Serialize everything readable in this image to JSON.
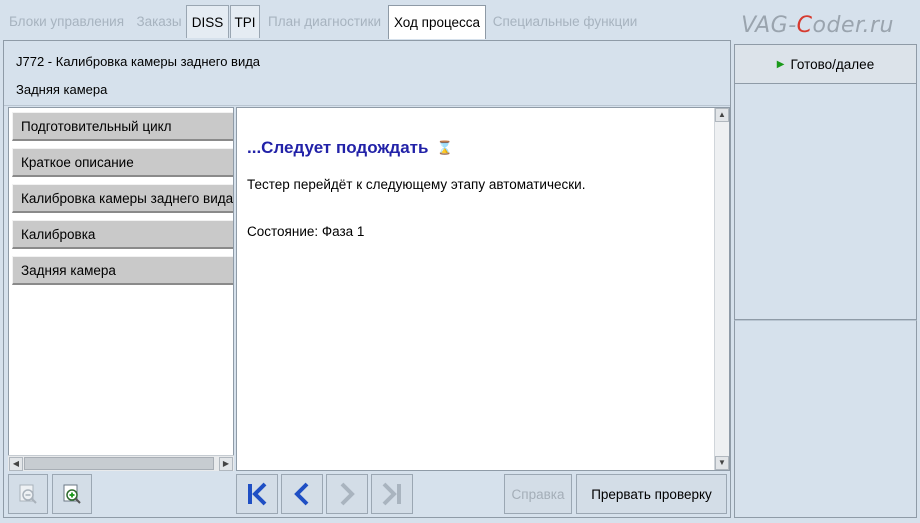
{
  "tabs": [
    {
      "label": "Блоки управления",
      "state": "disabled"
    },
    {
      "label": "Заказы",
      "state": "disabled"
    },
    {
      "label": "DISS",
      "state": "enabled"
    },
    {
      "label": "TPI",
      "state": "enabled"
    },
    {
      "label": "План диагностики",
      "state": "disabled"
    },
    {
      "label": "Ход процесса",
      "state": "active"
    },
    {
      "label": "Специальные функции",
      "state": "disabled"
    }
  ],
  "watermark": {
    "part1": "VAG-",
    "part2": "C",
    "part3": "oder.ru"
  },
  "header": {
    "title": "J772 - Калибровка камеры заднего вида",
    "subtitle": "Задняя камера"
  },
  "steps": [
    "Подготовительный цикл",
    "Краткое описание",
    "Калибровка камеры заднего вида",
    "Калибровка",
    "Задняя камера"
  ],
  "content": {
    "title": "...Следует подождать",
    "message": "Тестер перейдёт к следующему этапу автоматически.",
    "status": "Состояние: Фаза 1"
  },
  "toolbar": {
    "help_label": "Справка",
    "abort_label": "Прервать проверку"
  },
  "right_panel": {
    "ready_label": "Готово/далее"
  },
  "icons": {
    "zoom_out": "zoom-out-icon",
    "zoom_in": "zoom-in-icon",
    "first": "skip-to-first-icon",
    "back": "chevron-left-icon",
    "forward": "chevron-right-icon",
    "last": "skip-to-last-icon"
  },
  "colors": {
    "background": "#d6e1ec",
    "title_blue": "#2222a8",
    "nav_blue": "#1f4fc4",
    "play_green": "#1a9a1a",
    "watermark_red": "#d63a2f"
  }
}
